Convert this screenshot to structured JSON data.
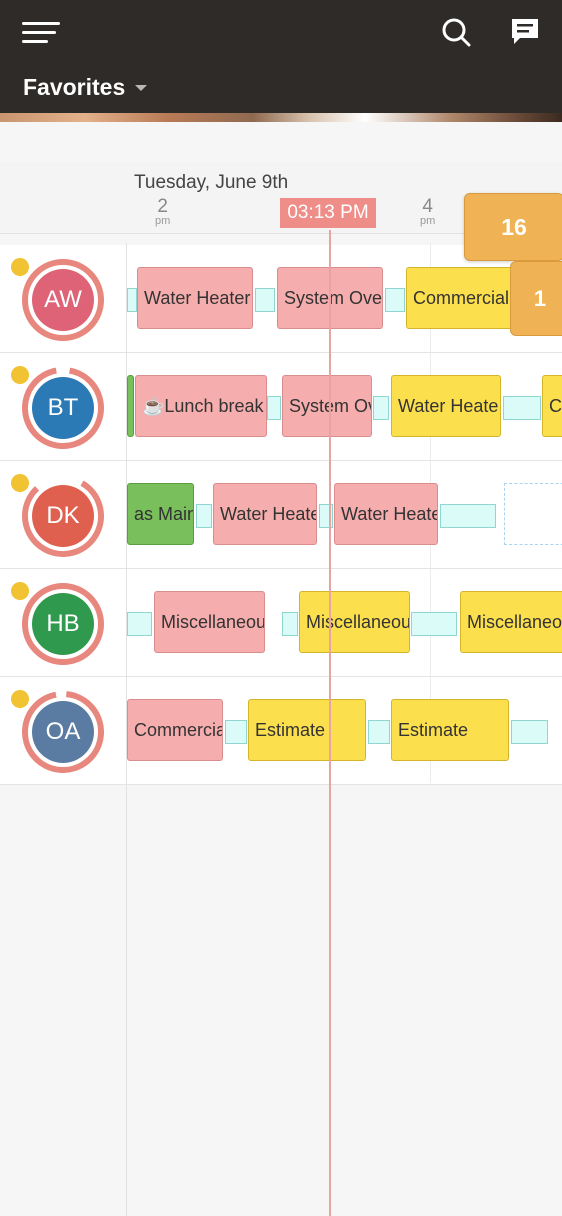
{
  "header": {
    "favorites_label": "Favorites"
  },
  "timeline": {
    "date": "Tuesday, June 9th",
    "hours": [
      {
        "num": "2",
        "ampm": "pm"
      },
      {
        "num": "4",
        "ampm": "pm"
      }
    ],
    "current_time": "03:13 PM",
    "overflow_count_primary": "16",
    "overflow_count_secondary": "1"
  },
  "technicians": [
    {
      "initials": "AW",
      "color": "#de6376"
    },
    {
      "initials": "BT",
      "color": "#2b7ab5"
    },
    {
      "initials": "DK",
      "color": "#e06050"
    },
    {
      "initials": "HB",
      "color": "#2f9a4e"
    },
    {
      "initials": "OA",
      "color": "#5a7ca3"
    }
  ],
  "appointments": {
    "aw": [
      "Water Heater",
      "System Ove",
      "Commercial"
    ],
    "bt": [
      "☕Lunch break",
      "System Ov",
      "Water Heate",
      "Co"
    ],
    "dk": [
      "as Main",
      "Water Heate",
      "Water Heate"
    ],
    "hb": [
      "Miscellaneou",
      "Miscellaneou",
      "Miscellaneo"
    ],
    "oa": [
      "Commercia",
      "Estimate",
      "Estimate"
    ]
  },
  "colors": {
    "header_bg": "#2f2b28",
    "now_badge": "#ef8d89",
    "pink_job": "#f5adad",
    "yellow_job": "#fbdf4c",
    "green_job": "#79bf5b",
    "travel": "#dbfbf8",
    "status_dot": "#f1c232",
    "overflow_badge": "#efb254"
  }
}
